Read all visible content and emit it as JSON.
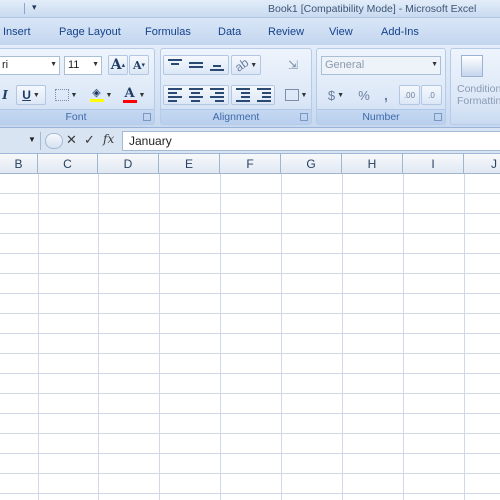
{
  "window": {
    "title": "Book1  [Compatibility Mode] - Microsoft Excel",
    "qat_dropdown_icon": "chevron-down-icon"
  },
  "tabs": [
    {
      "label": "Insert"
    },
    {
      "label": "Page Layout"
    },
    {
      "label": "Formulas"
    },
    {
      "label": "Data"
    },
    {
      "label": "Review"
    },
    {
      "label": "View"
    },
    {
      "label": "Add-Ins"
    }
  ],
  "ribbon": {
    "font_group": {
      "label": "Font",
      "font_name": "ri",
      "font_size": "11",
      "grow_font": "A",
      "shrink_font": "A",
      "italic": "I",
      "underline": "U",
      "fill_color": "#ffff00",
      "font_color": "#ff0000",
      "font_color_glyph": "A"
    },
    "alignment_group": {
      "label": "Alignment"
    },
    "number_group": {
      "label": "Number",
      "format": "General",
      "currency": "$",
      "percent": "%",
      "comma": ",",
      "increase_decimal": ".00",
      "decrease_decimal": ".0"
    },
    "styles_group": {
      "conditional_line1": "Condition",
      "conditional_line2": "Formatting"
    }
  },
  "formula_bar": {
    "cancel": "✕",
    "enter": "✓",
    "function": "fx",
    "value": "January"
  },
  "grid": {
    "columns": [
      "B",
      "C",
      "D",
      "E",
      "F",
      "G",
      "H",
      "I",
      "J"
    ],
    "gridline_color": "#d0d7e5"
  }
}
